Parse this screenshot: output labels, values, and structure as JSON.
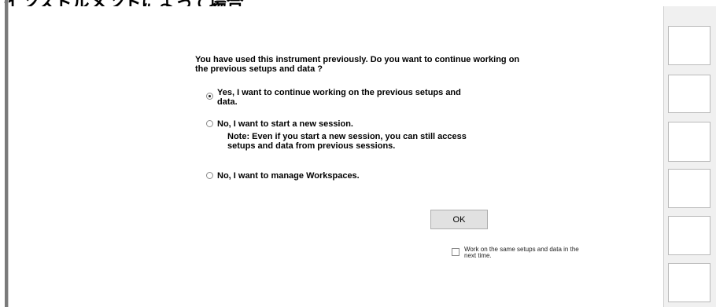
{
  "top_strip_text": "インストルメントによって場合",
  "prompt": {
    "question": "You have used this instrument previously. Do you want to continue working on the previous setups and data ?"
  },
  "options": [
    {
      "label": "Yes, I want to continue working on the previous setups and data.",
      "checked": true
    },
    {
      "label": "No, I want to start a new session.",
      "checked": false
    },
    {
      "label": "No, I want to manage Workspaces.",
      "checked": false
    }
  ],
  "note": "Note: Even if you start a new session, you can still access setups and data from previous sessions.",
  "ok_button": "OK",
  "remember_checkbox": {
    "label": "Work on the same setups and data in the next time.",
    "checked": false
  }
}
